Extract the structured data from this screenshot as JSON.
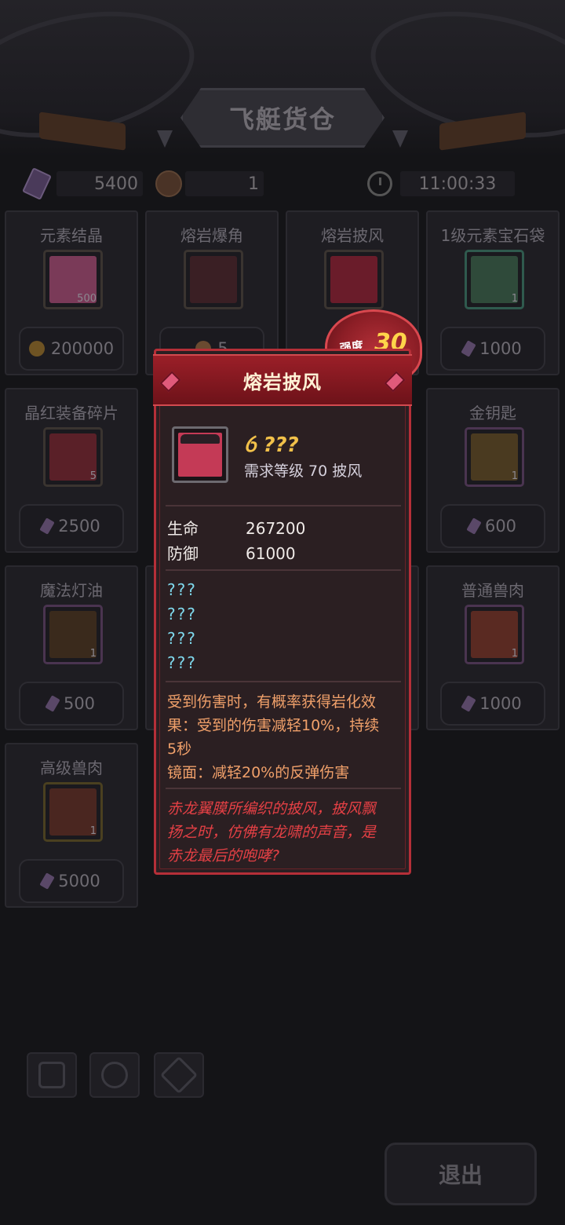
{
  "header": {
    "title": "飞艇货仓"
  },
  "currency": {
    "gems": "5400",
    "beast_tokens": "1",
    "timer": "11:00:33"
  },
  "shop_items": [
    {
      "name": "元素结晶",
      "count": "500",
      "price": "200000",
      "price_icon": "coin-icon",
      "color": "#7a3a58"
    },
    {
      "name": "熔岩爆角",
      "count": "",
      "price": "5",
      "price_icon": "beast-icon",
      "color": "#3a1f24"
    },
    {
      "name": "熔岩披风",
      "count": "",
      "price": "",
      "price_icon": "gem-icon",
      "color": "#8a2232"
    },
    {
      "name": "1级元素宝石袋",
      "count": "1",
      "price": "1000",
      "price_icon": "gem-icon",
      "color": "#2f4a3a"
    },
    {
      "name": "晶红装备碎片",
      "count": "5",
      "price": "2500",
      "price_icon": "gem-icon",
      "color": "#5a2028"
    },
    {
      "name": "金钥匙",
      "count": "1",
      "price": "600",
      "price_icon": "gem-icon",
      "color": "#4a3a20"
    },
    {
      "name": "魔法灯油",
      "count": "1",
      "price": "500",
      "price_icon": "gem-icon",
      "color": "#3a2a1c"
    },
    {
      "name": "普通兽肉",
      "count": "1",
      "price": "1000",
      "price_icon": "gem-icon",
      "color": "#5a2a22"
    },
    {
      "name": "高级兽肉",
      "count": "1",
      "price": "5000",
      "price_icon": "gem-icon",
      "color": "#4a2620"
    }
  ],
  "exit_label": "退出",
  "popup": {
    "title": "熔岩披风",
    "strength_label": "强度",
    "strength_value": "30",
    "quality": "???",
    "requirement": "需求等级 70   披风",
    "stats": [
      {
        "key": "生命",
        "value": "267200"
      },
      {
        "key": "防御",
        "value": "61000"
      }
    ],
    "unknown_attrs": [
      "???",
      "???",
      "???",
      "???"
    ],
    "effect_lines": [
      "受到伤害时，有概率获得岩化效",
      "果：受到的伤害减轻10%，持续",
      "5秒",
      "镜面：减轻20%的反弹伤害"
    ],
    "lore_lines": [
      "赤龙翼膜所编织的披风，披风飘",
      "扬之时，仿佛有龙啸的声音，是",
      "赤龙最后的咆哮?"
    ]
  },
  "colors": {
    "popup_border": "#b52f38",
    "quality": "#f2c14a",
    "unknown": "#7fd8ec",
    "effect": "#f0a06a",
    "lore": "#e54045"
  }
}
